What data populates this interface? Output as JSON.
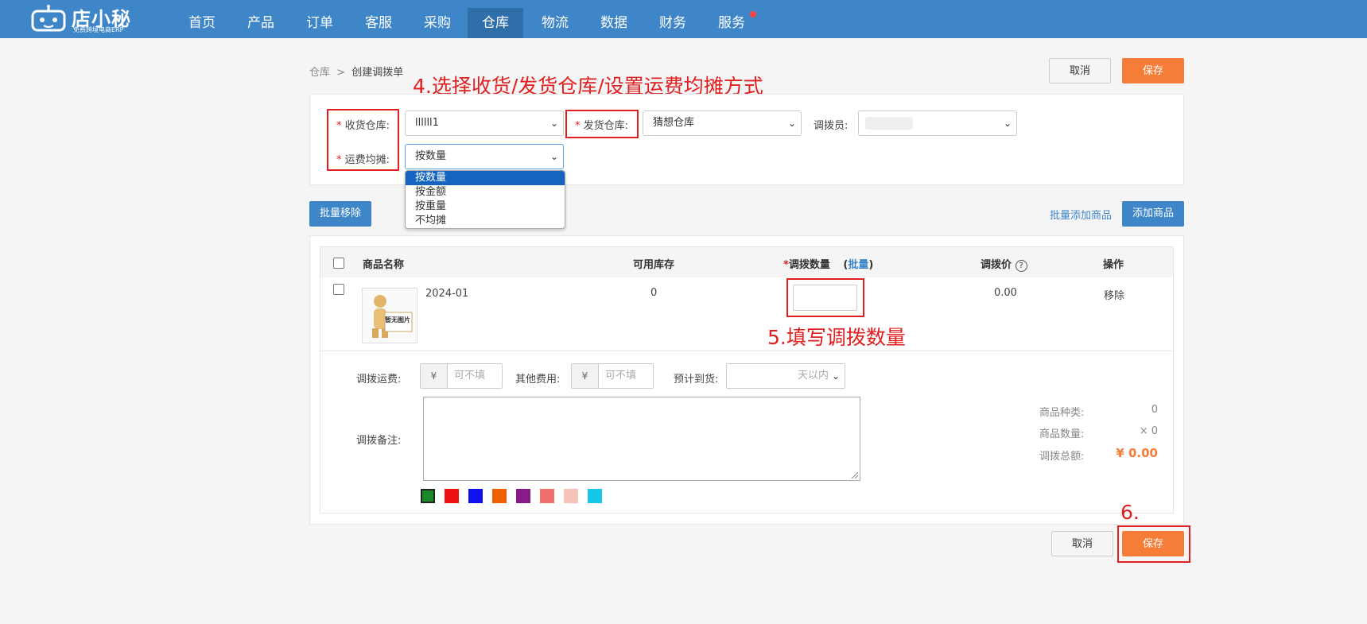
{
  "brand": {
    "title": "店小秘",
    "subtitle": "免费跨境电商ERP"
  },
  "nav": {
    "items": [
      "首页",
      "产品",
      "订单",
      "客服",
      "采购",
      "仓库",
      "物流",
      "数据",
      "财务",
      "服务"
    ],
    "active": "仓库"
  },
  "breadcrumb": {
    "root": "仓库",
    "separator": ">",
    "current": "创建调拨单"
  },
  "actions": {
    "cancel": "取消",
    "save": "保存"
  },
  "annotations": {
    "step4": "4.选择收货/发货仓库/设置运费均摊方式",
    "step5": "5.填写调拨数量",
    "step6": "6."
  },
  "form": {
    "receive_label": "收货仓库:",
    "receive_value": "llllll1",
    "send_label": "发货仓库:",
    "send_value": "猜想仓库",
    "operator_label": "调拨员:",
    "shipping_label": "运费均摊:",
    "shipping_value": "按数量",
    "shipping_options": [
      "按数量",
      "按金额",
      "按重量",
      "不均摊"
    ],
    "required_mark": "*"
  },
  "toolbar": {
    "batch_remove": "批量移除",
    "batch_add": "批量添加商品",
    "add_product": "添加商品"
  },
  "table": {
    "headers": {
      "name": "商品名称",
      "stock": "可用库存",
      "qty": "调拨数量",
      "qty_required": "*",
      "batch": "批量",
      "batch_open": "(",
      "batch_close": ")",
      "price": "调拨价",
      "price_help": "?",
      "ops": "操作"
    },
    "rows": [
      {
        "thumb_text": "暂无图片",
        "name": "2024-01",
        "stock": "0",
        "qty": "",
        "price": "0.00",
        "op": "移除"
      }
    ]
  },
  "fees": {
    "freight_label": "调拨运费:",
    "other_label": "其他费用:",
    "currency": "¥",
    "placeholder": "可不填",
    "eta_label": "预计到货:",
    "eta_suffix": "天以内",
    "note_label": "调拨备注:"
  },
  "colors": [
    "#1a8a2a",
    "#ee1111",
    "#1111ee",
    "#f06000",
    "#8a1a8a",
    "#f07070",
    "#f6c3b8",
    "#13c6ea"
  ],
  "summary": {
    "types_label": "商品种类:",
    "types_value": "0",
    "count_label": "商品数量:",
    "count_value": "× 0",
    "total_label": "调拨总额:",
    "total_value": "¥ 0.00"
  }
}
